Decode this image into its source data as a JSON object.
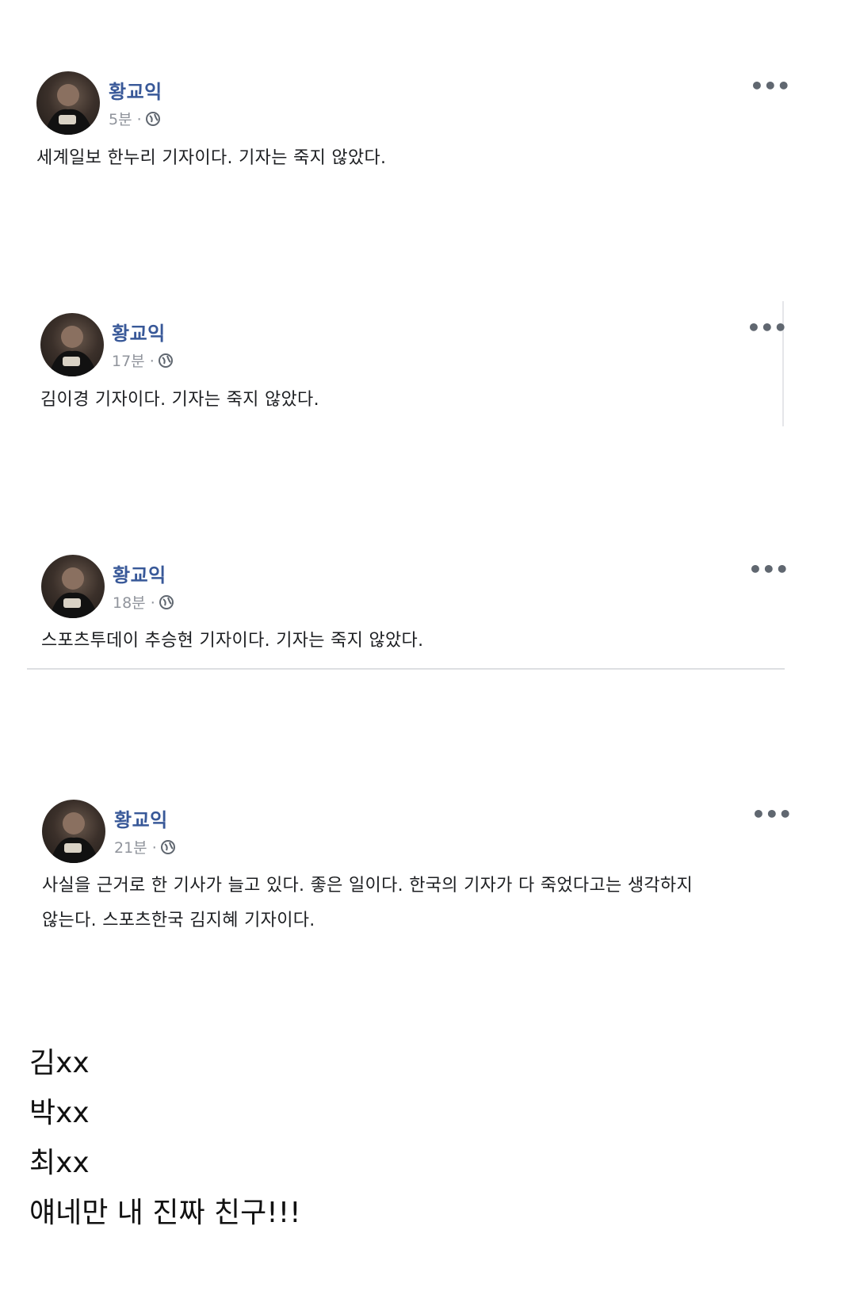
{
  "posts": [
    {
      "author": "황교익",
      "time": "5분 ·",
      "text_lines": [
        "세계일보 한누리 기자이다. 기자는 죽지 않았다."
      ],
      "more": "•••"
    },
    {
      "author": "황교익",
      "time": "17분 ·",
      "text_lines": [
        "김이경 기자이다. 기자는 죽지 않았다."
      ],
      "more": "•••"
    },
    {
      "author": "황교익",
      "time": "18분 ·",
      "text_lines": [
        "스포츠투데이 추승현 기자이다. 기자는 죽지 않았다."
      ],
      "more": "•••"
    },
    {
      "author": "황교익",
      "time": "21분 ·",
      "text_lines": [
        "사실을 근거로 한 기사가 늘고 있다. 좋은 일이다. 한국의 기자가 다 죽었다고는 생각하지",
        "않는다. 스포츠한국 김지혜 기자이다."
      ],
      "more": "•••"
    }
  ],
  "caption_lines": [
    "김xx",
    "박xx",
    "최xx",
    "얘네만 내 진짜 친구!!!"
  ],
  "colors": {
    "author": "#385898",
    "meta": "#90949c",
    "text": "#1c1e21",
    "divider": "#dddfe2"
  },
  "icons": [
    "avatar",
    "globe-icon",
    "more-options-icon"
  ]
}
